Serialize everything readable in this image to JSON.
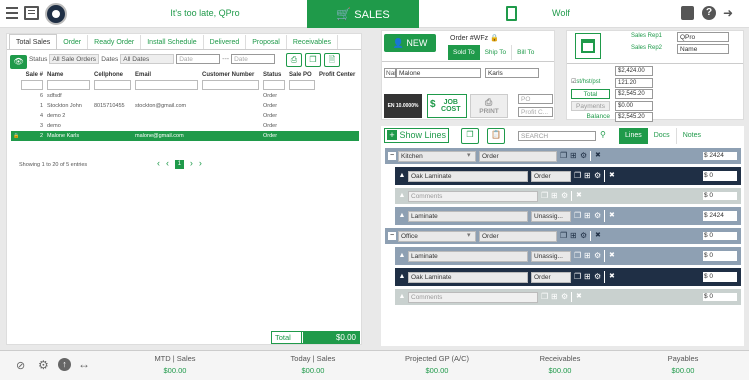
{
  "topbar": {
    "message": "It's too late, QPro",
    "sales_label": "SALES",
    "user": "Wolf"
  },
  "left": {
    "tabs": [
      "Total Sales",
      "Order",
      "Ready Order",
      "Install Schedule",
      "Delivered",
      "Proposal",
      "Receivables"
    ],
    "filters": {
      "status_label": "Status",
      "status_value": "All Sale Orders",
      "dates_label": "Dates",
      "dates_value": "All Dates",
      "date_from": "Date",
      "date_sep": "---",
      "date_to": "Date"
    },
    "columns": [
      "Sale #",
      "Name",
      "Cellphone",
      "Email",
      "Customer Number",
      "Status",
      "Sale PO",
      "Profit Center"
    ],
    "rows": [
      {
        "num": "6",
        "name": "sdfsdf",
        "phone": "",
        "email": "",
        "cust": "",
        "status": "Order",
        "po": "",
        "pc": ""
      },
      {
        "num": "1",
        "name": "Stockton John",
        "phone": "8015710455",
        "email": "stockton@gmail.com",
        "cust": "",
        "status": "Order",
        "po": "",
        "pc": ""
      },
      {
        "num": "4",
        "name": "demo 2",
        "phone": "",
        "email": "",
        "cust": "",
        "status": "Order",
        "po": "",
        "pc": ""
      },
      {
        "num": "3",
        "name": "demo",
        "phone": "",
        "email": "",
        "cust": "",
        "status": "Order",
        "po": "",
        "pc": ""
      },
      {
        "num": "2",
        "name": "Malone Karls",
        "phone": "",
        "email": "malone@gmail.com",
        "cust": "",
        "status": "Order",
        "po": "",
        "pc": ""
      }
    ],
    "showing": "Showing 1 to 20 of 5 entries",
    "page": "1",
    "total_label": "Total",
    "total_value": "$0.00"
  },
  "order": {
    "new_label": "NEW",
    "order_label": "Order #WFz",
    "subtabs": [
      "Sold To",
      "Ship To",
      "Bill To"
    ],
    "name_label": "Name",
    "first_name": "Malone",
    "last_name": "Karls",
    "en_label": "EN 10.0000%",
    "job_cost_label": "JOB COST",
    "print_label": "PRINT",
    "po_placeholder": "PO",
    "profit_placeholder": "Profit C..."
  },
  "summary": {
    "sales_rep1_label": "Sales Rep1",
    "sales_rep1": "QPro",
    "sales_rep2_label": "Sales Rep2",
    "sales_rep2": "Name",
    "subtotal_label": "Subtotal",
    "subtotal": "$2,424.00",
    "tax_label": "st/hst/pst",
    "tax": "121.20",
    "total_label": "Total",
    "total": "$2,545.20",
    "payments_label": "Payments",
    "payments": "$0.00",
    "balance_label": "Balance",
    "balance": "$2,545.20"
  },
  "lines_toolbar": {
    "show_lines": "Show Lines",
    "search_placeholder": "SEARCH",
    "tabs": [
      "Lines",
      "Docs",
      "Notes"
    ]
  },
  "lines": [
    {
      "kind": "room",
      "name": "Kitchen",
      "status": "Order",
      "amount": "$ 2424"
    },
    {
      "kind": "item",
      "name": "Oak Laminate",
      "status": "Order",
      "amount": "$ 0"
    },
    {
      "kind": "comment",
      "name": "Comments",
      "amount": "$ 0"
    },
    {
      "kind": "item2",
      "name": "Laminate",
      "status": "Unassig...",
      "amount": "$ 2424"
    },
    {
      "kind": "room",
      "name": "Office",
      "status": "Order",
      "amount": "$ 0"
    },
    {
      "kind": "item2",
      "name": "Laminate",
      "status": "Unassig...",
      "amount": "$ 0"
    },
    {
      "kind": "item",
      "name": "Oak Laminate",
      "status": "Order",
      "amount": "$ 0"
    },
    {
      "kind": "comment",
      "name": "Comments",
      "amount": "$ 0"
    }
  ],
  "footer": {
    "stats": [
      {
        "label": "MTD | Sales",
        "value": "$00.00"
      },
      {
        "label": "Today | Sales",
        "value": "$00.00"
      },
      {
        "label": "Projected GP (A/C)",
        "value": "$00.00"
      },
      {
        "label": "Receivables",
        "value": "$00.00"
      },
      {
        "label": "Payables",
        "value": "$00.00"
      }
    ]
  },
  "colors": {
    "accent": "#1f9a4a",
    "navy": "#1f2f45",
    "slate": "#8ea0b3",
    "lightslate": "#c9d1cf"
  }
}
